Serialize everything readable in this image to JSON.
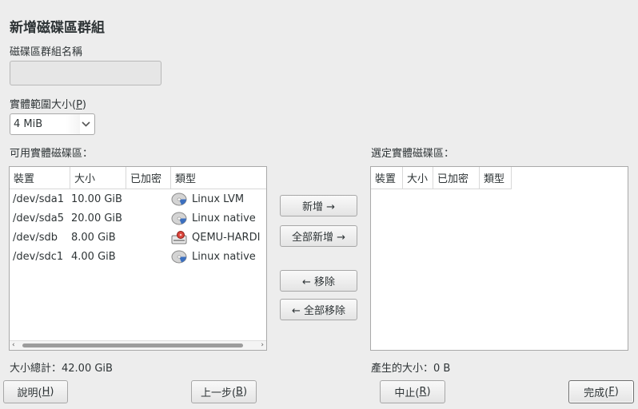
{
  "dialog": {
    "title": "新增磁碟區群組",
    "vg_name_label": "磁碟區群組名稱",
    "vg_name_value": "",
    "extent_label_pre": "實體範圍大小(",
    "extent_label_key": "P",
    "extent_label_post": ")",
    "extent_value": "4 MiB"
  },
  "available": {
    "label": "可用實體磁碟區：",
    "columns": [
      "裝置",
      "大小",
      "已加密",
      "類型"
    ],
    "rows": [
      {
        "device": "/dev/sda1",
        "size": "10.00 GiB",
        "encrypted": "",
        "type": "Linux LVM",
        "icon": "disk-partition-icon"
      },
      {
        "device": "/dev/sda5",
        "size": "20.00 GiB",
        "encrypted": "",
        "type": "Linux native",
        "icon": "disk-partition-icon"
      },
      {
        "device": "/dev/sdb",
        "size": "8.00 GiB",
        "encrypted": "",
        "type": "QEMU-HARDI",
        "icon": "hard-drive-icon"
      },
      {
        "device": "/dev/sdc1",
        "size": "4.00 GiB",
        "encrypted": "",
        "type": "Linux native",
        "icon": "disk-partition-icon"
      }
    ],
    "total": "大小總計：42.00 GiB"
  },
  "selected": {
    "label": "選定實體磁碟區：",
    "columns": [
      "裝置",
      "大小",
      "已加密",
      "類型"
    ],
    "rows": [],
    "total": "產生的大小：0 B"
  },
  "actions": {
    "add": "新增 →",
    "add_all": "全部新增 →",
    "remove": "← 移除",
    "remove_all": "← 全部移除"
  },
  "footer": {
    "help_pre": "說明(",
    "help_key": "H",
    "help_post": ")",
    "back_pre": "上一步(",
    "back_key": "B",
    "back_post": ")",
    "cancel_pre": "中止(",
    "cancel_key": "R",
    "cancel_post": ")",
    "finish_pre": "完成(",
    "finish_key": "F",
    "finish_post": ")"
  }
}
